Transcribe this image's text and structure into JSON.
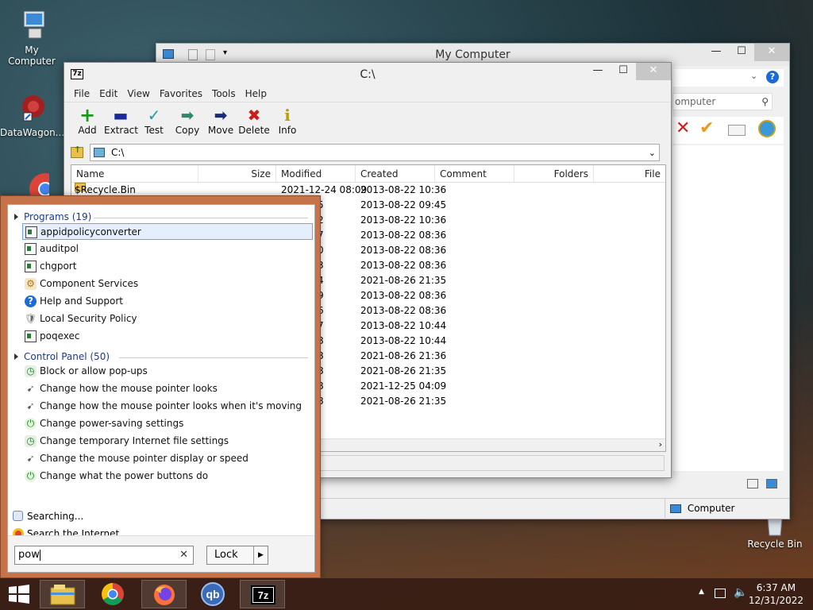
{
  "desktop": {
    "icons": [
      {
        "label": "My Computer"
      },
      {
        "label": "DataWagon..."
      },
      {
        "label": "Recycle Bin"
      }
    ]
  },
  "explorer": {
    "title": "My Computer",
    "search_placeholder": "omputer",
    "status_item": "Computer"
  },
  "sevenzip": {
    "title": "C:\\",
    "logo": "7z",
    "menu": [
      "File",
      "Edit",
      "View",
      "Favorites",
      "Tools",
      "Help"
    ],
    "toolbar": [
      {
        "label": "Add",
        "icon": "+",
        "color": "#1a9a1a"
      },
      {
        "label": "Extract",
        "icon": "▬",
        "color": "#1a2a9a"
      },
      {
        "label": "Test",
        "icon": "✓",
        "color": "#1aa0a0"
      },
      {
        "label": "Copy",
        "icon": "➡",
        "color": "#2a8a6a"
      },
      {
        "label": "Move",
        "icon": "➡",
        "color": "#1a2a7a"
      },
      {
        "label": "Delete",
        "icon": "✖",
        "color": "#d01a1a"
      },
      {
        "label": "Info",
        "icon": "i",
        "color": "#b8a000"
      }
    ],
    "address": "C:\\",
    "columns": [
      "Name",
      "Size",
      "Modified",
      "Created",
      "Comment",
      "Folders",
      "File"
    ],
    "rows": [
      {
        "name": "$Recycle.Bin",
        "modified": "2021-12-24 08:09",
        "created": "2013-08-22 10:36"
      },
      {
        "name": "",
        "modified": "22 09:45",
        "created": "2013-08-22 09:45"
      },
      {
        "name": "",
        "modified": "22 10:22",
        "created": "2013-08-22 10:36"
      },
      {
        "name": "",
        "modified": "31 06:17",
        "created": "2013-08-22 08:36"
      },
      {
        "name": "",
        "modified": "27 01:30",
        "created": "2013-08-22 08:36"
      },
      {
        "name": "",
        "modified": "31 08:43",
        "created": "2013-08-22 08:36"
      },
      {
        "name": "",
        "modified": "26 14:44",
        "created": "2021-08-26 21:35"
      },
      {
        "name": "",
        "modified": "24 08:09",
        "created": "2013-08-22 08:36"
      },
      {
        "name": "",
        "modified": "31 06:06",
        "created": "2013-08-22 08:36"
      },
      {
        "name": "",
        "modified": "21 04:17",
        "created": "2013-08-22 10:44"
      },
      {
        "name": "",
        "modified": "18 07:18",
        "created": "2013-08-22 10:44"
      },
      {
        "name": "",
        "modified": "31 04:48",
        "created": "2021-08-26 21:36"
      },
      {
        "name": "",
        "modified": "31 04:48",
        "created": "2021-08-26 21:35"
      },
      {
        "name": "",
        "modified": "23 12:58",
        "created": "2021-12-25 04:09"
      },
      {
        "name": "",
        "modified": "31 04:48",
        "created": "2021-08-26 21:35"
      }
    ]
  },
  "startmenu": {
    "programs_header": "Programs (19)",
    "programs": [
      {
        "label": "appidpolicyconverter",
        "icon": "program-icon"
      },
      {
        "label": "auditpol",
        "icon": "program-icon"
      },
      {
        "label": "chgport",
        "icon": "program-icon"
      },
      {
        "label": "Component Services",
        "icon": "component-services-icon"
      },
      {
        "label": "Help and Support",
        "icon": "help-icon"
      },
      {
        "label": "Local Security Policy",
        "icon": "security-policy-icon"
      },
      {
        "label": "poqexec",
        "icon": "program-icon"
      }
    ],
    "control_header": "Control Panel (50)",
    "control": [
      {
        "label": "Block or allow pop-ups",
        "icon": "internet-options-icon"
      },
      {
        "label": "Change how the mouse pointer looks",
        "icon": "mouse-icon"
      },
      {
        "label": "Change how the mouse pointer looks when it's moving",
        "icon": "mouse-icon"
      },
      {
        "label": "Change power-saving settings",
        "icon": "power-options-icon"
      },
      {
        "label": "Change temporary Internet file settings",
        "icon": "internet-options-icon"
      },
      {
        "label": "Change the mouse pointer display or speed",
        "icon": "mouse-icon"
      },
      {
        "label": "Change what the power buttons do",
        "icon": "power-options-icon"
      }
    ],
    "searching": "Searching...",
    "search_internet": "Search the Internet",
    "search_value": "pow",
    "lock_label": "Lock"
  },
  "taskbar": {
    "time": "6:37 AM",
    "date": "12/31/2022",
    "apps": [
      "file-explorer-icon",
      "chrome-icon",
      "firefox-icon",
      "qbittorrent-icon",
      "7zip-icon"
    ]
  }
}
